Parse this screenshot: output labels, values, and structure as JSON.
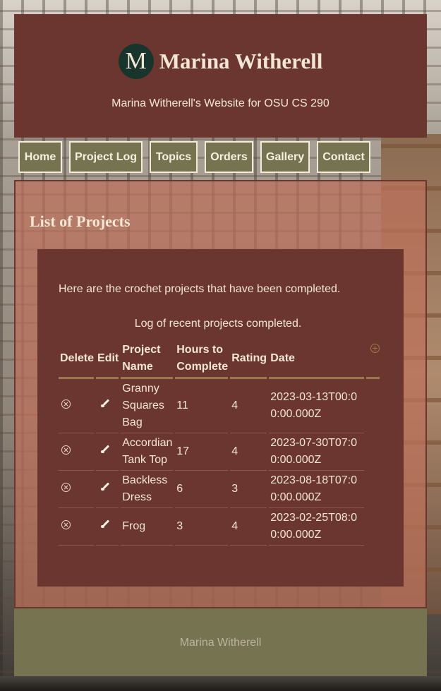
{
  "header": {
    "logo_letter": "M",
    "title": "Marina Witherell",
    "subtitle": "Marina Witherell's Website for OSU CS 290"
  },
  "nav": {
    "items": [
      {
        "label": "Home"
      },
      {
        "label": "Project Log"
      },
      {
        "label": "Topics"
      },
      {
        "label": "Orders"
      },
      {
        "label": "Gallery"
      },
      {
        "label": "Contact"
      }
    ]
  },
  "main": {
    "heading": "List of Projects",
    "intro": "Here are the crochet projects that have been completed.",
    "caption": "Log of recent projects completed.",
    "table": {
      "headers": {
        "delete": "Delete",
        "edit": "Edit",
        "name": "Project Name",
        "hours": "Hours to Complete",
        "rating": "Rating",
        "date": "Date"
      },
      "rows": [
        {
          "name": "Granny Squares Bag",
          "hours": "11",
          "rating": "4",
          "date": "2023-03-13T00:00:00.000Z"
        },
        {
          "name": "Accordian Tank Top",
          "hours": "17",
          "rating": "4",
          "date": "2023-07-30T07:00:00.000Z"
        },
        {
          "name": "Backless Dress",
          "hours": "6",
          "rating": "3",
          "date": "2023-08-18T07:00:00.000Z"
        },
        {
          "name": "Frog",
          "hours": "3",
          "rating": "4",
          "date": "2023-02-25T08:00:00.000Z"
        }
      ]
    }
  },
  "footer": {
    "text": "Marina Witherell"
  },
  "colors": {
    "header_bg": "#6b3630",
    "nav_bg": "#767350",
    "footer_bg": "#767350",
    "text_light": "#f3e6d4",
    "logo_bg": "#17352c"
  },
  "icons": {
    "delete": "circled-x-icon",
    "edit": "paintbrush-icon",
    "add": "circled-plus-icon"
  }
}
